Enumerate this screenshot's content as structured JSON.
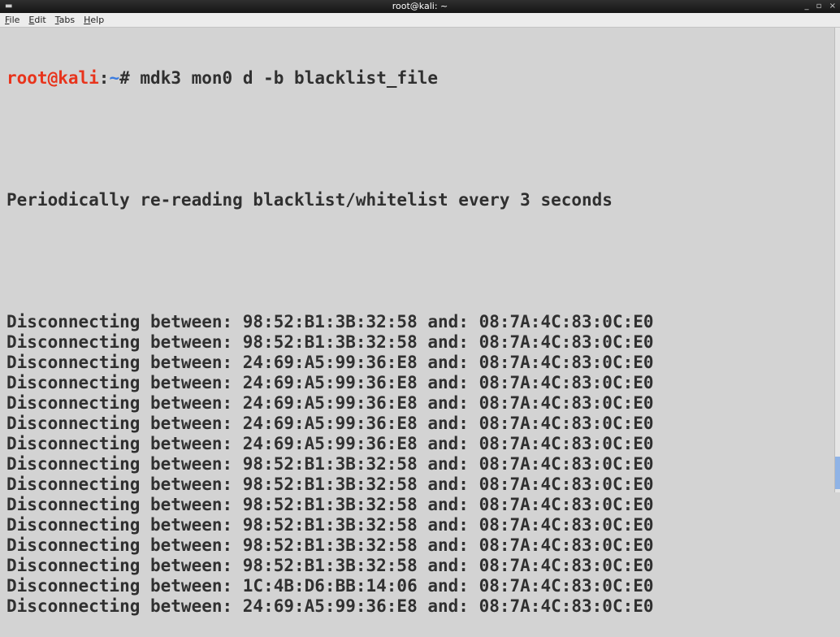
{
  "window": {
    "title": "root@kali: ~",
    "controls": "_ ▫ ×"
  },
  "menu": [
    "File",
    "Edit",
    "Tabs",
    "Help"
  ],
  "terminal": {
    "prompt_user": "root@kali",
    "prompt_sep": ":",
    "prompt_path": "~",
    "prompt_symbol": "# ",
    "command": "mdk3 mon0 d -b blacklist_file",
    "info_line": "Periodically re-reading blacklist/whitelist every 3 seconds",
    "output_lines": [
      "Disconnecting between: 98:52:B1:3B:32:58 and: 08:7A:4C:83:0C:E0",
      "Disconnecting between: 98:52:B1:3B:32:58 and: 08:7A:4C:83:0C:E0",
      "Disconnecting between: 24:69:A5:99:36:E8 and: 08:7A:4C:83:0C:E0",
      "Disconnecting between: 24:69:A5:99:36:E8 and: 08:7A:4C:83:0C:E0",
      "Disconnecting between: 24:69:A5:99:36:E8 and: 08:7A:4C:83:0C:E0",
      "Disconnecting between: 24:69:A5:99:36:E8 and: 08:7A:4C:83:0C:E0",
      "Disconnecting between: 24:69:A5:99:36:E8 and: 08:7A:4C:83:0C:E0",
      "Disconnecting between: 98:52:B1:3B:32:58 and: 08:7A:4C:83:0C:E0",
      "Disconnecting between: 98:52:B1:3B:32:58 and: 08:7A:4C:83:0C:E0",
      "Disconnecting between: 98:52:B1:3B:32:58 and: 08:7A:4C:83:0C:E0",
      "Disconnecting between: 98:52:B1:3B:32:58 and: 08:7A:4C:83:0C:E0",
      "Disconnecting between: 98:52:B1:3B:32:58 and: 08:7A:4C:83:0C:E0",
      "Disconnecting between: 98:52:B1:3B:32:58 and: 08:7A:4C:83:0C:E0",
      "Disconnecting between: 1C:4B:D6:BB:14:06 and: 08:7A:4C:83:0C:E0",
      "Disconnecting between: 24:69:A5:99:36:E8 and: 08:7A:4C:83:0C:E0"
    ]
  },
  "colors": {
    "prompt_user": "#e8341c",
    "prompt_path": "#3a7be0",
    "terminal_bg": "#d3d3d3",
    "terminal_fg": "#303030"
  }
}
